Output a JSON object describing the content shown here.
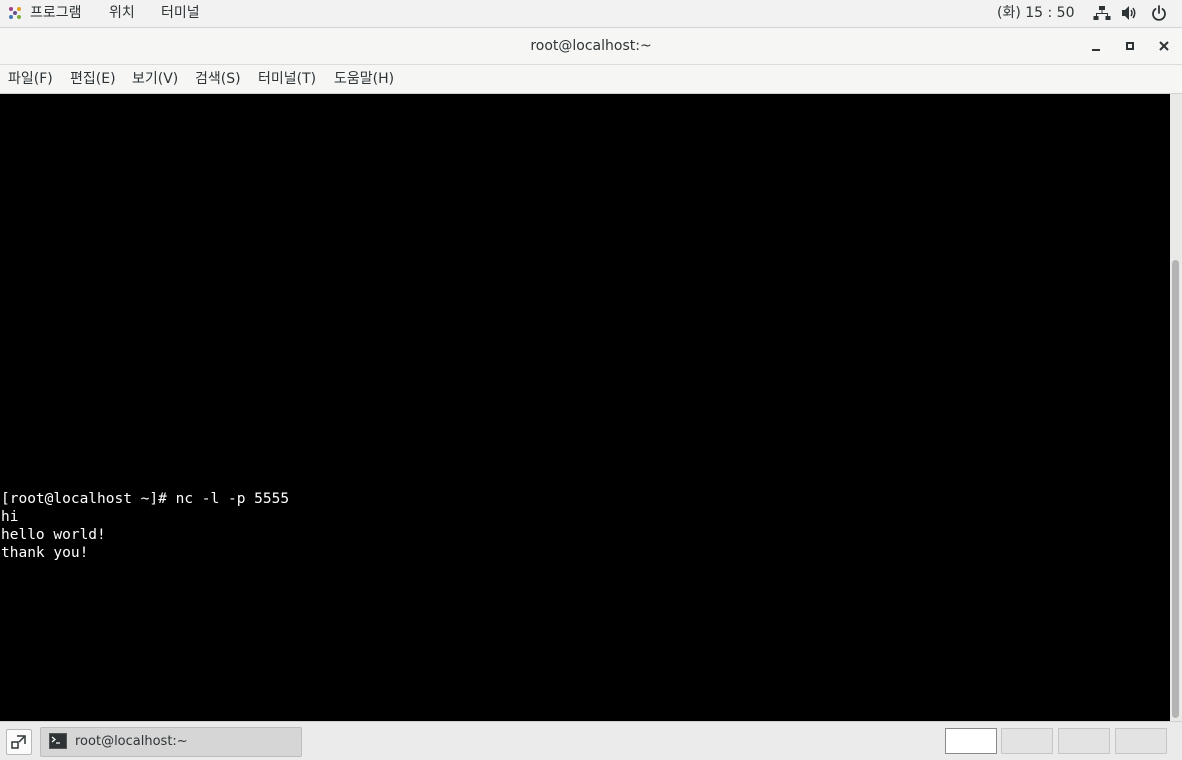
{
  "top_panel": {
    "applications": "프로그램",
    "places": "위치",
    "terminal_app": "터미널",
    "clock": "(화) 15 : 50",
    "icons": [
      "network-icon",
      "volume-icon",
      "power-icon"
    ]
  },
  "window": {
    "title": "root@localhost:~",
    "controls": [
      "minimize-icon",
      "maximize-icon",
      "close-icon"
    ]
  },
  "menubar": {
    "items": [
      "파일(F)",
      "편집(E)",
      "보기(V)",
      "검색(S)",
      "터미널(T)",
      "도움말(H)"
    ]
  },
  "terminal": {
    "background": "#000000",
    "foreground": "#ffffff",
    "lines": [
      "[root@localhost ~]# nc -l -p 5555",
      "hi",
      "hello world!",
      "thank you!"
    ]
  },
  "taskbar": {
    "window_label": "root@localhost:~",
    "active_workspace": 1,
    "workspace_count": 4
  }
}
